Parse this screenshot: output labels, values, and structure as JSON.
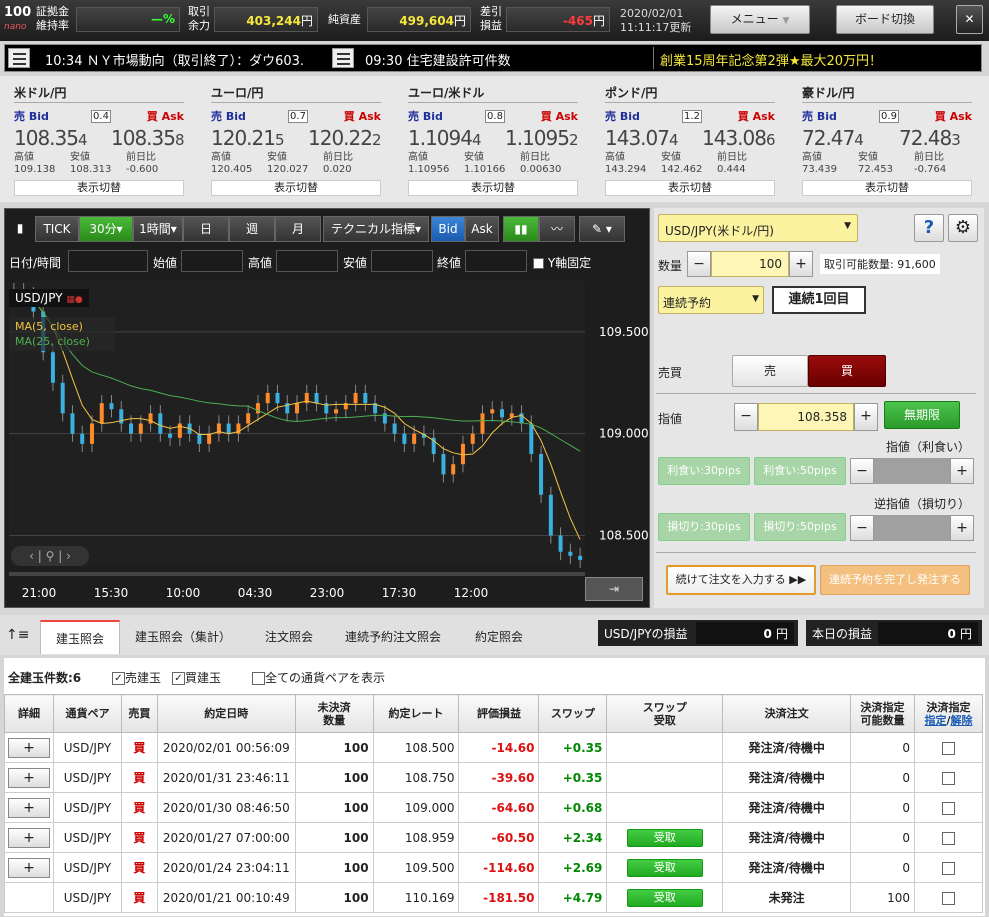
{
  "top": {
    "logo_main": "100",
    "logo_sub": "nano",
    "margin_label": "証拠金\n維持率",
    "margin_value": "—%",
    "cash_label": "取引\n余力",
    "cash_value": "403,244",
    "cash_unit": "円",
    "net_label": "純資産",
    "net_value": "499,604",
    "net_unit": "円",
    "pl_label": "差引\n損益",
    "pl_value": "-465",
    "pl_unit": "円",
    "date": "2020/02/01",
    "time": "11:11:17更新",
    "menu": "メニュー",
    "board": "ボード切換",
    "close": "✕",
    "color_yellow": "#f5e83a",
    "color_red": "#ff3b3b"
  },
  "news": {
    "item1": "10:34 ＮＹ市場動向（取引終了）：ダウ603.",
    "item2": "09:30 住宅建設許可件数",
    "promo": "創業15周年記念第2弾★最大20万円！"
  },
  "rates": [
    {
      "pair": "米ドル/円",
      "spread": "0.4",
      "bid_main": "108.35",
      "bid_last": "4",
      "ask_main": "108.35",
      "ask_last": "8",
      "high": "109.138",
      "low": "108.313",
      "chg": "-0.600"
    },
    {
      "pair": "ユーロ/円",
      "spread": "0.7",
      "bid_main": "120.21",
      "bid_last": "5",
      "ask_main": "120.22",
      "ask_last": "2",
      "high": "120.405",
      "low": "120.027",
      "chg": "0.020"
    },
    {
      "pair": "ユーロ/米ドル",
      "spread": "0.8",
      "bid_main": "1.1094",
      "bid_last": "4",
      "ask_main": "1.1095",
      "ask_last": "2",
      "high": "1.10956",
      "low": "1.10166",
      "chg": "0.00630"
    },
    {
      "pair": "ポンド/円",
      "spread": "1.2",
      "bid_main": "143.07",
      "bid_last": "4",
      "ask_main": "143.08",
      "ask_last": "6",
      "high": "143.294",
      "low": "142.462",
      "chg": "0.444"
    },
    {
      "pair": "豪ドル/円",
      "spread": "0.9",
      "bid_main": "72.47",
      "bid_last": "4",
      "ask_main": "72.48",
      "ask_last": "3",
      "high": "73.439",
      "low": "72.453",
      "chg": "-0.764"
    }
  ],
  "rate_labels": {
    "bid": "売 Bid",
    "ask": "買 Ask",
    "high": "高値",
    "low": "安値",
    "chg": "前日比",
    "switch": "表示切替"
  },
  "chart_toolbar": {
    "tick": "TICK",
    "min30": "30分",
    "hour1": "1時間",
    "day": "日",
    "week": "週",
    "month": "月",
    "tech": "テクニカル指標",
    "bid": "Bid",
    "ask": "Ask"
  },
  "chart_fields": {
    "date": "日付/時間",
    "open": "始値",
    "high": "高値",
    "low": "安値",
    "close": "終値",
    "yfix": "Y軸固定"
  },
  "chart_data": {
    "type": "line",
    "title": "USD/JPY",
    "series": [
      {
        "name": "MA(5, close)",
        "color": "#f5c542"
      },
      {
        "name": "MA(25, close)",
        "color": "#4caf50"
      }
    ],
    "y_ticks": [
      "109.500",
      "109.000",
      "108.500"
    ],
    "x_ticks": [
      "21:00",
      "15:30",
      "10:00",
      "04:30",
      "23:00",
      "17:30",
      "12:00"
    ],
    "ylim": [
      108.35,
      109.75
    ],
    "close": [
      109.7,
      109.68,
      109.6,
      109.4,
      109.25,
      109.1,
      109.0,
      108.95,
      109.05,
      109.15,
      109.12,
      109.05,
      109.0,
      109.05,
      109.1,
      109.0,
      108.98,
      109.05,
      109.0,
      108.95,
      109.0,
      109.05,
      109.0,
      109.05,
      109.1,
      109.15,
      109.2,
      109.15,
      109.1,
      109.15,
      109.2,
      109.15,
      109.1,
      109.12,
      109.15,
      109.2,
      109.15,
      109.1,
      109.05,
      109.0,
      108.95,
      109.0,
      108.98,
      108.9,
      108.8,
      108.85,
      108.95,
      109.0,
      109.1,
      109.12,
      109.08,
      109.1,
      109.05,
      108.9,
      108.7,
      108.5,
      108.42,
      108.4,
      108.38
    ]
  },
  "order": {
    "pair": "USD/JPY(米ドル/円)",
    "help": "?",
    "qty_label": "数量",
    "qty": "100",
    "avail": "取引可能数量: 91,600",
    "type": "連続予約",
    "seq": "連続1回目",
    "side_label": "売買",
    "sell": "売",
    "buy": "買",
    "price_label": "指値",
    "price": "108.358",
    "expiry": "無期限",
    "tp_label": "指値（利食い）",
    "tp30": "利食い:30pips",
    "tp50": "利食い:50pips",
    "sl_label": "逆指値（損切り）",
    "sl30": "損切り:30pips",
    "sl50": "損切り:50pips",
    "continue": "続けて注文を入力する",
    "complete": "連続予約を完了し発注する"
  },
  "tabs": {
    "t1": "建玉照会",
    "t2": "建玉照会（集計）",
    "t3": "注文照会",
    "t4": "連続予約注文照会",
    "t5": "約定照会",
    "pl_usd": "USD/JPYの損益",
    "pl_usd_val": "0",
    "pl_today": "本日の損益",
    "pl_today_val": "0",
    "unit": "円"
  },
  "grid": {
    "count": "全建玉件数:6",
    "sell_pos": "売建玉",
    "buy_pos": "買建玉",
    "all_pairs": "全ての通貨ペアを表示",
    "headers": [
      "詳細",
      "通貨ペア",
      "売買",
      "約定日時",
      "未決済\n数量",
      "約定レート",
      "評価損益",
      "スワップ",
      "スワップ\n受取",
      "決済注文",
      "決済指定\n可能数量",
      "決済指定"
    ],
    "h_spec": "指定",
    "h_clear": "解除",
    "rows": [
      {
        "pair": "USD/JPY",
        "side": "買",
        "date": "2020/02/01 00:56:09",
        "qty": "100",
        "rate": "108.500",
        "pl": "-14.60",
        "swap": "+0.35",
        "recv": "",
        "status": "発注済/待機中",
        "avail": "0"
      },
      {
        "pair": "USD/JPY",
        "side": "買",
        "date": "2020/01/31 23:46:11",
        "qty": "100",
        "rate": "108.750",
        "pl": "-39.60",
        "swap": "+0.35",
        "recv": "",
        "status": "発注済/待機中",
        "avail": "0"
      },
      {
        "pair": "USD/JPY",
        "side": "買",
        "date": "2020/01/30 08:46:50",
        "qty": "100",
        "rate": "109.000",
        "pl": "-64.60",
        "swap": "+0.68",
        "recv": "",
        "status": "発注済/待機中",
        "avail": "0"
      },
      {
        "pair": "USD/JPY",
        "side": "買",
        "date": "2020/01/27 07:00:00",
        "qty": "100",
        "rate": "108.959",
        "pl": "-60.50",
        "swap": "+2.34",
        "recv": "受取",
        "status": "発注済/待機中",
        "avail": "0"
      },
      {
        "pair": "USD/JPY",
        "side": "買",
        "date": "2020/01/24 23:04:11",
        "qty": "100",
        "rate": "109.500",
        "pl": "-114.60",
        "swap": "+2.69",
        "recv": "受取",
        "status": "発注済/待機中",
        "avail": "0"
      },
      {
        "pair": "USD/JPY",
        "side": "買",
        "date": "2020/01/21 00:10:49",
        "qty": "100",
        "rate": "110.169",
        "pl": "-181.50",
        "swap": "+4.79",
        "recv": "受取",
        "status": "未発注",
        "avail": "100"
      }
    ]
  }
}
